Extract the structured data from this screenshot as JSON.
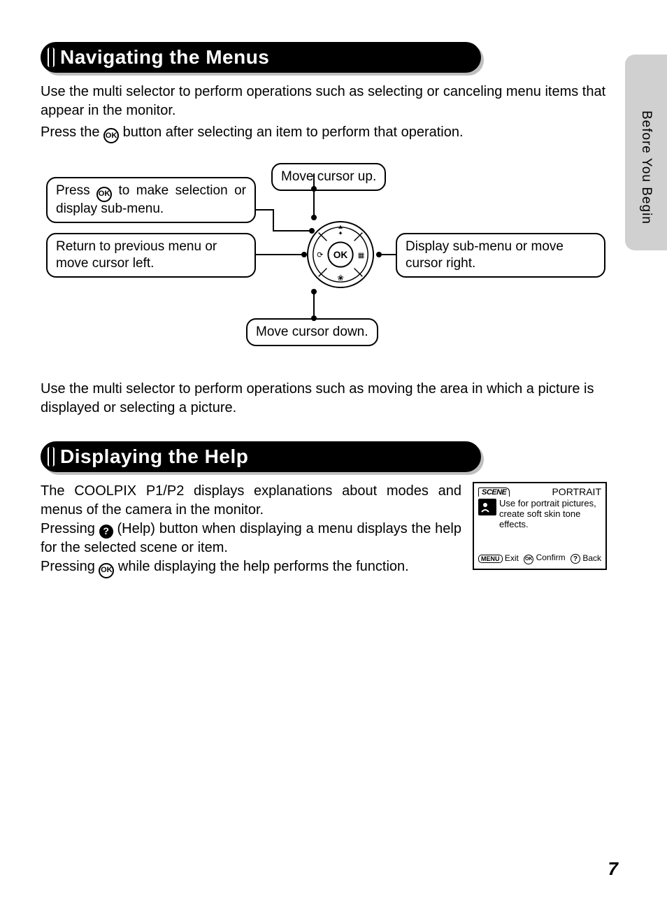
{
  "sidebar": {
    "label": "Before You Begin"
  },
  "section1": {
    "heading": "Navigating the Menus",
    "para1": "Use the multi selector to perform operations such as selecting or canceling menu items that appear in the monitor.",
    "para2a": "Press the ",
    "para2b": " button after selecting an item to perform that operation.",
    "callouts": {
      "up": "Move cursor up.",
      "ok_line1": "Press ",
      "ok_line2": " to make selection or display sub-menu.",
      "left": "Return to previous menu or move cursor left.",
      "right": "Display sub-menu or move cursor right.",
      "down": "Move cursor down."
    },
    "para3": "Use the multi selector to perform operations such as moving the area in which a picture is displayed or selecting a picture."
  },
  "section2": {
    "heading": "Displaying the Help",
    "para1": "The COOLPIX P1/P2 displays explanations about modes and menus of the camera in the monitor.",
    "para2a": "Pressing ",
    "para2b": " (Help) button when displaying a menu displays the help for the selected scene or item.",
    "para3a": "Pressing ",
    "para3b": " while displaying the help performs the function."
  },
  "lcd": {
    "scene": "SCENE",
    "title": "PORTRAIT",
    "desc": "Use for portrait pictures, create soft skin tone effects.",
    "menu": "MENU",
    "exit": "Exit",
    "confirm": "Confirm",
    "back": "Back"
  },
  "icons": {
    "ok": "OK",
    "help": "?"
  },
  "page": "7"
}
